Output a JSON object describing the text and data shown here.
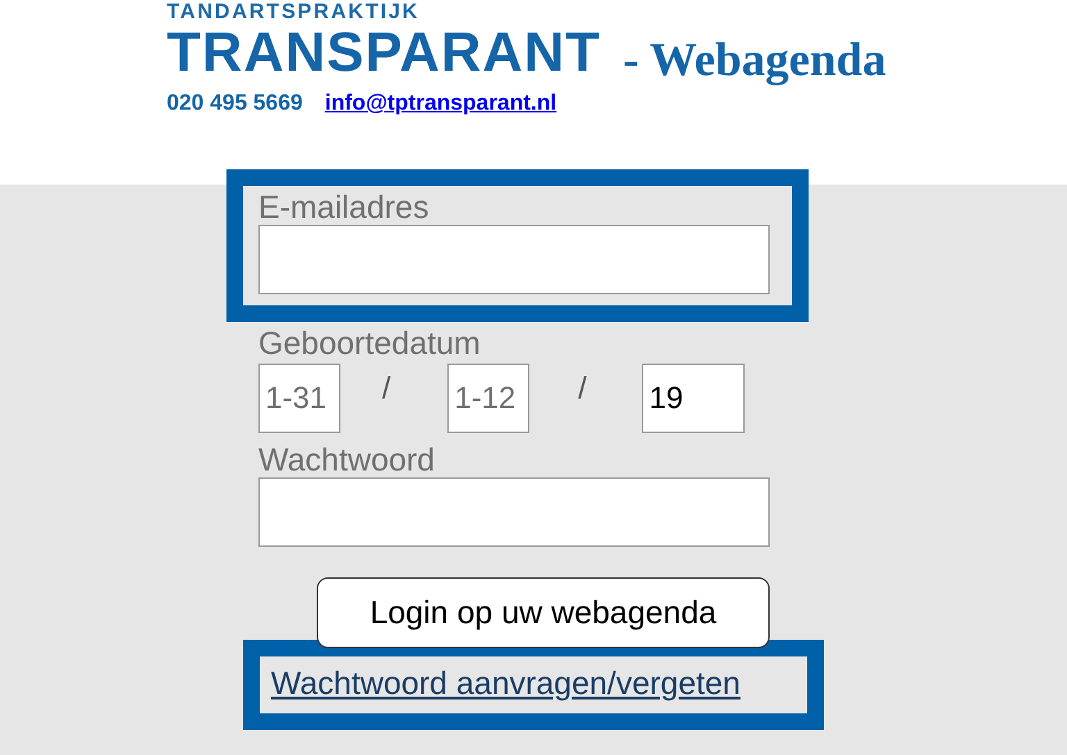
{
  "header": {
    "brand_small": "TANDARTSPRAKTIJK",
    "brand": "TRANSPARANT",
    "title": "- Webagenda",
    "phone": "020 495 5669",
    "email_link": "info@tptransparant.nl"
  },
  "form": {
    "email": {
      "label": "E-mailadres",
      "highlighted": true
    },
    "birthdate": {
      "label": "Geboortedatum",
      "day": {
        "placeholder": "1-31"
      },
      "separator_1": "/",
      "month": {
        "placeholder": "1-12"
      },
      "separator_2": "/",
      "year": {
        "value": "19"
      }
    },
    "password": {
      "label": "Wachtwoord"
    },
    "login_button": "Login op uw webagenda",
    "forgot_link": {
      "text": "Wachtwoord aanvragen/vergeten",
      "highlighted": true
    }
  }
}
